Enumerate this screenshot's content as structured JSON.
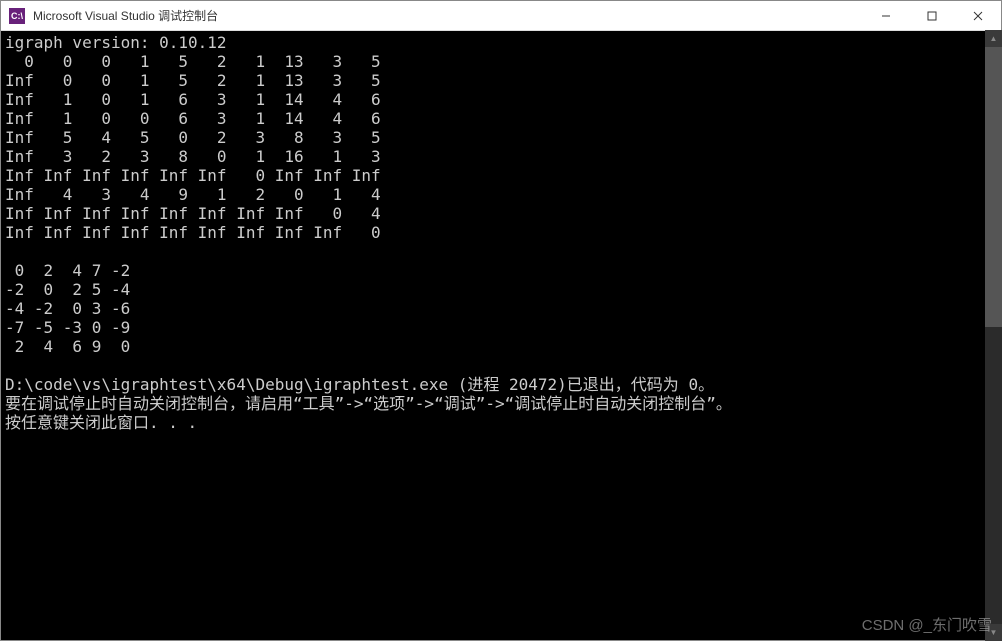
{
  "window": {
    "icon_text": "C:\\",
    "title": "Microsoft Visual Studio 调试控制台"
  },
  "console": {
    "version_line": "igraph version: 0.10.12",
    "matrix1": [
      "  0   0   0   1   5   2   1  13   3   5",
      "Inf   0   0   1   5   2   1  13   3   5",
      "Inf   1   0   1   6   3   1  14   4   6",
      "Inf   1   0   0   6   3   1  14   4   6",
      "Inf   5   4   5   0   2   3   8   3   5",
      "Inf   3   2   3   8   0   1  16   1   3",
      "Inf Inf Inf Inf Inf Inf   0 Inf Inf Inf",
      "Inf   4   3   4   9   1   2   0   1   4",
      "Inf Inf Inf Inf Inf Inf Inf Inf   0   4",
      "Inf Inf Inf Inf Inf Inf Inf Inf Inf   0"
    ],
    "matrix2": [
      " 0  2  4 7 -2",
      "-2  0  2 5 -4",
      "-4 -2  0 3 -6",
      "-7 -5 -3 0 -9",
      " 2  4  6 9  0"
    ],
    "exit_line": "D:\\code\\vs\\igraphtest\\x64\\Debug\\igraphtest.exe (进程 20472)已退出，代码为 0。",
    "hint_line": "要在调试停止时自动关闭控制台，请启用“工具”->“选项”->“调试”->“调试停止时自动关闭控制台”。",
    "prompt_line": "按任意键关闭此窗口. . ."
  },
  "watermark": "CSDN @_东门吹雪"
}
